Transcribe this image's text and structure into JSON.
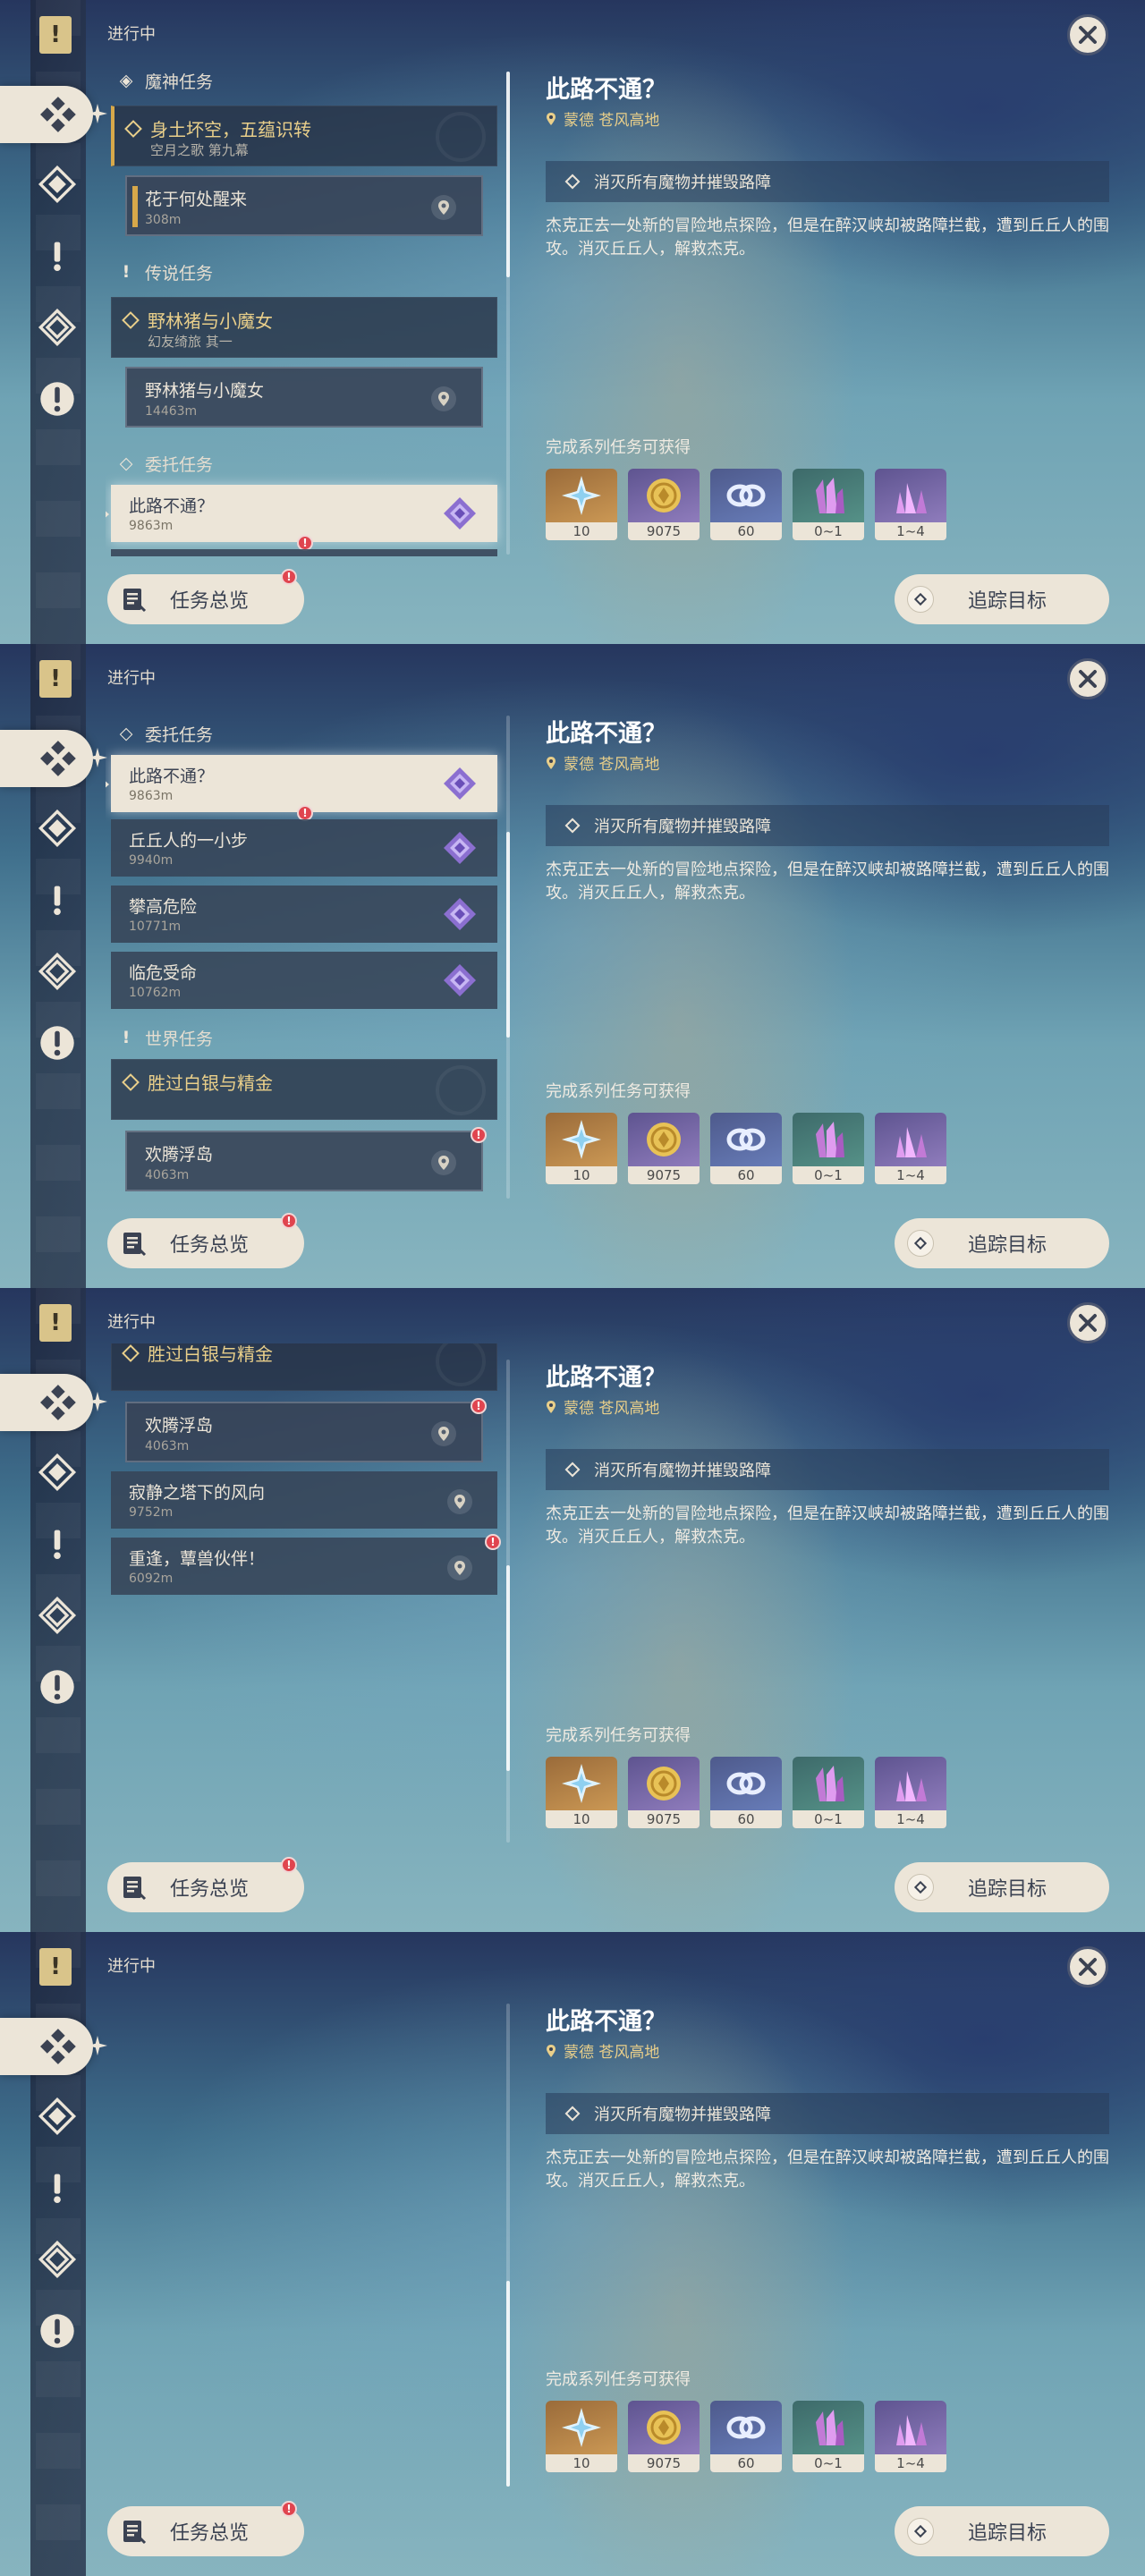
{
  "header": {
    "in_progress": "进行中"
  },
  "detail": {
    "title": "此路不通？",
    "location": "蒙德 苍风高地",
    "objective": "消灭所有魔物并摧毁路障",
    "description": "杰克正去一处新的冒险地点探险，但是在醉汉峡却被路障拦截，遭到丘丘人的围攻。消灭丘丘人，解救杰克。",
    "rewards_label": "完成系列任务可获得",
    "rewards": [
      {
        "icon": "intertwined-fate-icon",
        "count": "10"
      },
      {
        "icon": "mora-coin-icon",
        "count": "9075"
      },
      {
        "icon": "adventure-exp-icon",
        "count": "60"
      },
      {
        "icon": "crystal-chunk-green-icon",
        "count": "0~1"
      },
      {
        "icon": "crystal-chunk-purple-icon",
        "count": "1~4"
      }
    ]
  },
  "buttons": {
    "overview": "任务总览",
    "track": "追踪目标"
  },
  "categories": {
    "archon": "魔神任务",
    "story": "传说任务",
    "commission": "委托任务",
    "world": "世界任务"
  },
  "quests": {
    "archon_parent": {
      "title": "身土坏空，五蕴识转",
      "sub": "空月之歌 第九幕"
    },
    "archon_child": {
      "title": "花于何处醒来",
      "dist": "308m"
    },
    "story_parent": {
      "title": "野林猪与小魔女",
      "sub": "幻友绮旅 其一"
    },
    "story_child": {
      "title": "野林猪与小魔女",
      "dist": "14463m"
    },
    "c1": {
      "title": "此路不通？",
      "dist": "9863m"
    },
    "c2": {
      "title": "丘丘人的一小步",
      "dist": "9940m"
    },
    "c3": {
      "title": "攀高危险",
      "dist": "10771m"
    },
    "c4": {
      "title": "临危受命",
      "dist": "10762m"
    },
    "world_parent": {
      "title": "胜过白银与精金"
    },
    "w1": {
      "title": "欢腾浮岛",
      "dist": "4063m"
    },
    "w2": {
      "title": "寂静之塔下的风向",
      "dist": "9752m"
    },
    "w3": {
      "title": "重逢，蕈兽伙伴！",
      "dist": "6092m"
    }
  },
  "colors": {
    "accent_gold": "#e9cf8a",
    "cream": "#ece5d8",
    "alert_red": "#e0454f",
    "commission_purple": "#9a85c6"
  }
}
